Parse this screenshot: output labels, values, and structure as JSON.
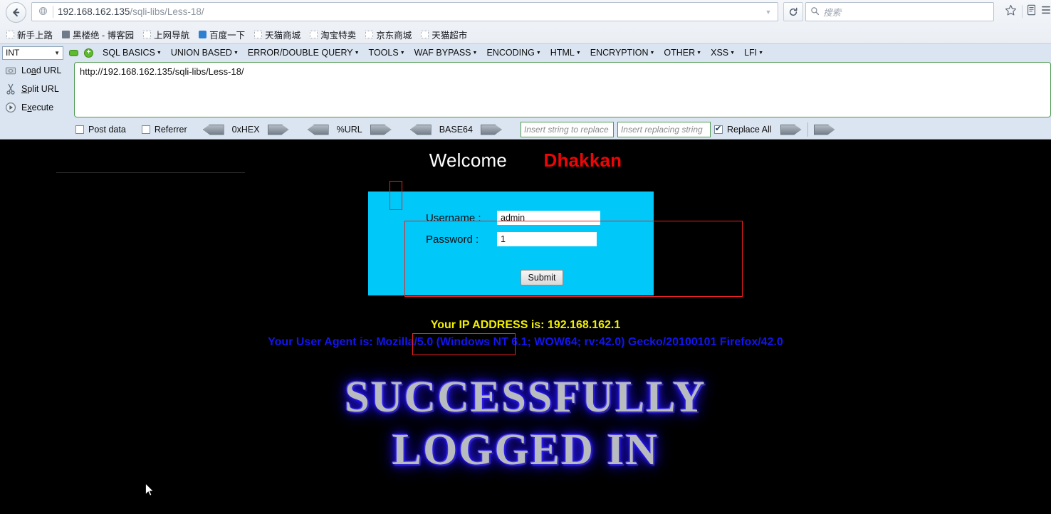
{
  "browser": {
    "back_icon": "back-arrow",
    "url_host": "192.168.162.135",
    "url_path": "/sqli-libs/Less-18/",
    "dropdown_icon": "chevron-down-icon",
    "reload_icon": "⟳",
    "search_placeholder": "搜索",
    "search_icon": "search-icon",
    "star_icon": "★",
    "reader_icon": "reader-mode-icon",
    "menu_icon": "menu-icon",
    "bookmarks": [
      {
        "label": "新手上路",
        "icon": "blank-page-icon"
      },
      {
        "label": "黑楼绝 - 博客园",
        "icon": "site-icon"
      },
      {
        "label": "上网导航",
        "icon": "blank-page-icon"
      },
      {
        "label": "百度一下",
        "icon": "baidu-icon"
      },
      {
        "label": "天猫商城",
        "icon": "blank-page-icon"
      },
      {
        "label": "淘宝特卖",
        "icon": "blank-page-icon"
      },
      {
        "label": "京东商城",
        "icon": "blank-page-icon"
      },
      {
        "label": "天猫超市",
        "icon": "blank-page-icon"
      }
    ]
  },
  "hackbar": {
    "type_select_value": "INT",
    "minus_label": "−",
    "plus_label": "+",
    "menus": [
      "SQL BASICS",
      "UNION BASED",
      "ERROR/DOUBLE QUERY",
      "TOOLS",
      "WAF BYPASS",
      "ENCODING",
      "HTML",
      "ENCRYPTION",
      "OTHER",
      "XSS",
      "LFI"
    ],
    "actions": [
      {
        "label": "Load URL",
        "icon": "load-url-icon"
      },
      {
        "label": "Split URL",
        "icon": "scissors-icon"
      },
      {
        "label": "Execute",
        "icon": "play-icon"
      }
    ],
    "url_value": "http://192.168.162.135/sqli-libs/Less-18/",
    "post_data_label": "Post data",
    "post_data_checked": false,
    "referrer_label": "Referrer",
    "referrer_checked": false,
    "encoders": [
      "0xHEX",
      "%URL",
      "BASE64"
    ],
    "replace_search_placeholder": "Insert string to replace",
    "replace_with_placeholder": "Insert replacing string",
    "replace_all_label": "Replace All",
    "replace_all_checked": true
  },
  "page": {
    "welcome_text": "Welcome",
    "user_name": "Dhakkan",
    "form": {
      "username_label": "Username :",
      "username_value": "admin",
      "password_label": "Password :",
      "password_value": "1",
      "submit_label": "Submit"
    },
    "ip_line": "Your IP ADDRESS is: 192.168.162.1",
    "user_agent_prefix": "Your User Agent",
    "user_agent_rest": " is: Mozilla/5.0 (Windows NT 6.1; WOW64; rv:42.0) Gecko/20100101 Firefox/42.0",
    "success_line_1": "SUCCESSFULLY",
    "success_line_2": "LOGGED IN"
  },
  "colors": {
    "panel_cyan": "#00c8f8",
    "accent_red": "#ee0505",
    "annotation_red": "#ef2020",
    "ip_yellow": "#f2ef00",
    "ua_blue": "#1414f0",
    "hackbar_bg": "#dbe5f1"
  }
}
